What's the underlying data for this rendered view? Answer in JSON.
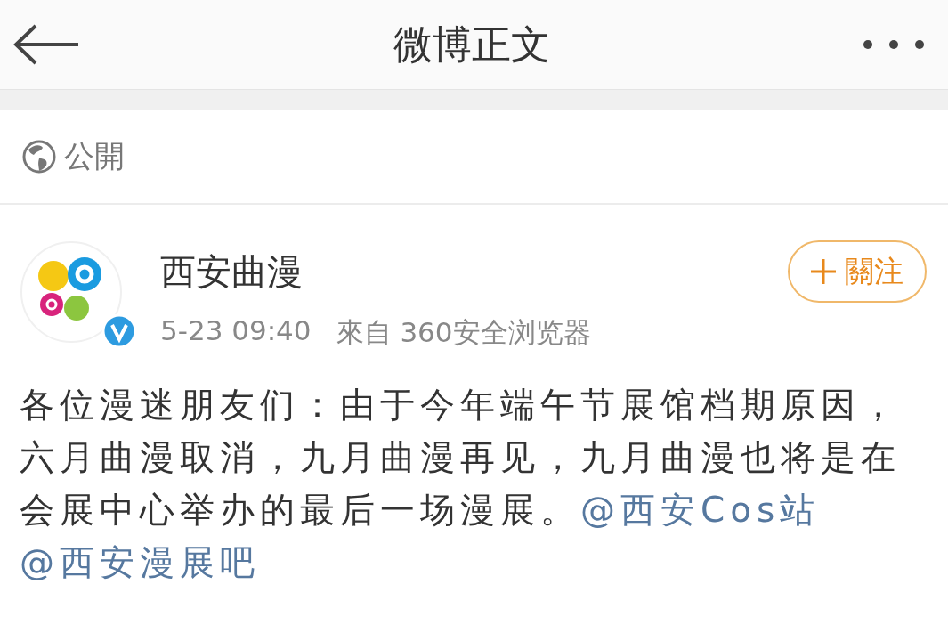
{
  "header": {
    "title": "微博正文"
  },
  "visibility": {
    "label": "公開"
  },
  "post": {
    "author": "西安曲漫",
    "verified": true,
    "time": "5-23 09:40",
    "source": "來自 360安全浏览器",
    "follow_button": {
      "label": "關注"
    },
    "body": [
      {
        "kind": "text",
        "text": "各位漫迷朋友们：由于今年端午节展馆档期原因，六月曲漫取消，九月曲漫再见，九月曲漫也将是在会展中心举办的最后一场漫展。"
      },
      {
        "kind": "mention",
        "text": "@西安Cos站"
      },
      {
        "kind": "mention",
        "text": "@西安漫展吧"
      }
    ]
  }
}
